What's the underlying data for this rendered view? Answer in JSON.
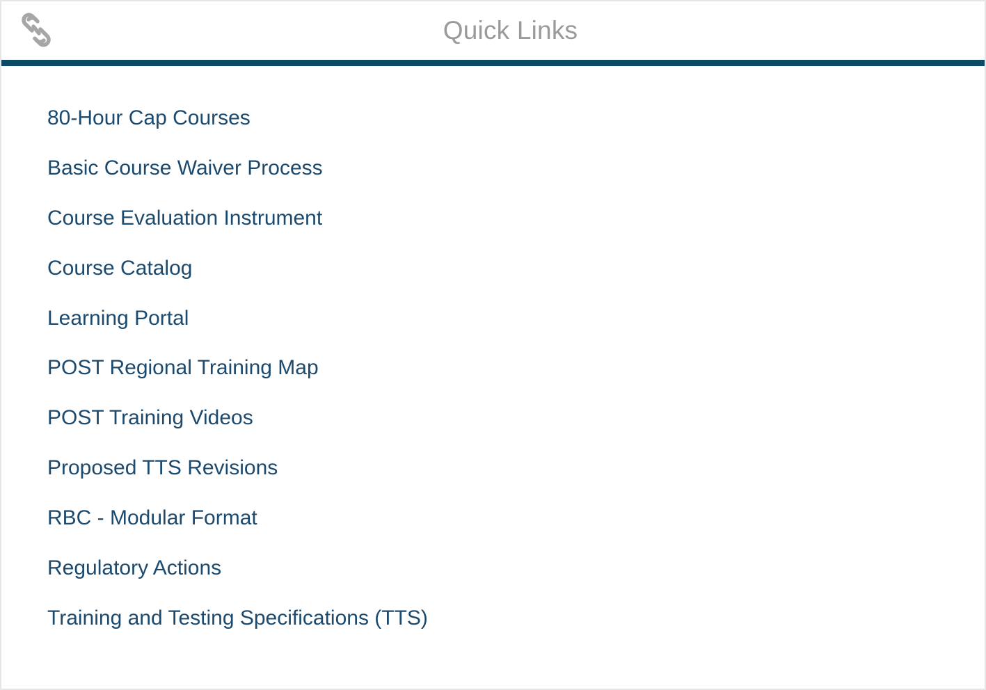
{
  "header": {
    "icon": "link-icon",
    "title": "Quick Links"
  },
  "colors": {
    "accent_rule": "#0d4a66",
    "link_text": "#1c4a6e",
    "title_text": "#9a9a9a",
    "icon_stroke": "#a6a6a6"
  },
  "links": [
    {
      "label": "80-Hour Cap Courses"
    },
    {
      "label": "Basic Course Waiver Process"
    },
    {
      "label": "Course Evaluation Instrument"
    },
    {
      "label": "Course Catalog"
    },
    {
      "label": "Learning Portal"
    },
    {
      "label": "POST Regional Training Map"
    },
    {
      "label": "POST Training Videos"
    },
    {
      "label": "Proposed TTS Revisions"
    },
    {
      "label": "RBC - Modular Format"
    },
    {
      "label": "Regulatory Actions"
    },
    {
      "label": "Training and Testing Specifications (TTS)"
    }
  ]
}
